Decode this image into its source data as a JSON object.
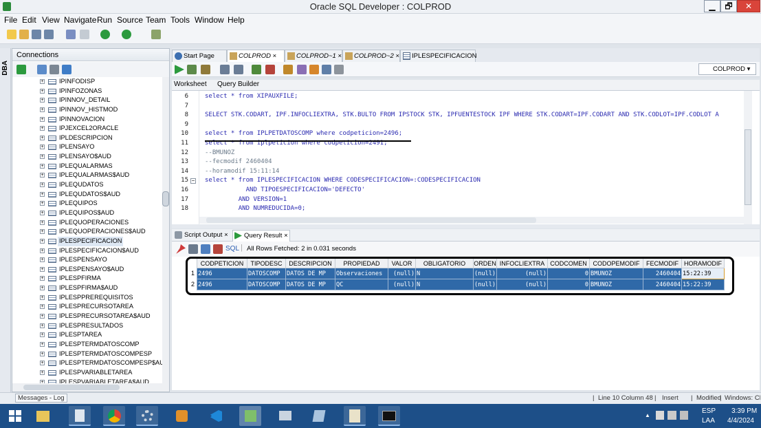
{
  "window": {
    "title": "Oracle SQL Developer : COLPROD",
    "minimize": "▁",
    "restore": "🗗",
    "close": "✕"
  },
  "menu": [
    "File",
    "Edit",
    "View",
    "Navigate",
    "Run",
    "Source",
    "Team",
    "Tools",
    "Window",
    "Help"
  ],
  "left_panel": {
    "side_tab": "DBA",
    "header": "Connections",
    "items": [
      "IPINFODISP",
      "IPINFOZONAS",
      "IPINNOV_DETAIL",
      "IPINNOV_HISTMOD",
      "IPINNOVACION",
      "IPJEXCEL2ORACLE",
      "IPLDESCRIPCION",
      "IPLENSAYO",
      "IPLENSAYO$AUD",
      "IPLEQUALARMAS",
      "IPLEQUALARMAS$AUD",
      "IPLEQUDATOS",
      "IPLEQUDATOS$AUD",
      "IPLEQUIPOS",
      "IPLEQUIPOS$AUD",
      "IPLEQUOPERACIONES",
      "IPLEQUOPERACIONES$AUD",
      "IPLESPECIFICACION",
      "IPLESPECIFICACION$AUD",
      "IPLESPENSAYO",
      "IPLESPENSAYO$AUD",
      "IPLESPFIRMA",
      "IPLESPFIRMA$AUD",
      "IPLESPPREREQUISITOS",
      "IPLESPRECURSOTAREA",
      "IPLESPRECURSOTAREA$AUD",
      "IPLESPRESULTADOS",
      "IPLESPTAREA",
      "IPLESPTERMDATOSCOMP",
      "IPLESPTERMDATOSCOMPESP",
      "IPLESPTERMDATOSCOMPESP$AUD",
      "IPLESPVARIABLETAREA",
      "IPLESPVARIABLETAREA$AUD"
    ],
    "selected_index": 17
  },
  "tabs": [
    {
      "label": "Start Page"
    },
    {
      "label": "COLPROD"
    },
    {
      "label": "COLPROD~1"
    },
    {
      "label": "COLPROD~2"
    },
    {
      "label": "IPLESPECIFICACION"
    }
  ],
  "connection_selector": "COLPROD",
  "subtabs": {
    "worksheet": "Worksheet",
    "query_builder": "Query Builder"
  },
  "editor": {
    "line_numbers": [
      "6",
      "7",
      "8",
      "9",
      "10",
      "11",
      "12",
      "13",
      "14",
      "15",
      "16",
      "17",
      "18"
    ],
    "lines": [
      "select * from XIPAUXFILE;",
      "",
      "SELECT STK.CODART, IPF.INFOCLIEXTRA, STK.BULTO FROM IPSTOCK STK, IPFUENTESTOCK IPF WHERE STK.CODART=IPF.CODART AND STK.CODLOT=IPF.CODLOT A",
      "",
      "select * from IPLPETDATOSCOMP where codpeticion=2496;",
      "select * from iplpeticion where codpeticion=2491;",
      "--BMUNOZ",
      "--fecmodif 2460404",
      "--horamodif 15:11:14",
      "select * from IPLESPECIFICACION WHERE CODESPECIFICACION=:CODESPECIFICACION",
      "           AND TIPOESPECIFICACION='DEFECTO'",
      "         AND VERSION=1",
      "         AND NUMREDUCIDA=0;"
    ]
  },
  "output_tabs": {
    "script_output": "Script Output",
    "query_result": "Query Result",
    "close": "×"
  },
  "result_toolbar": {
    "sql": "SQL",
    "fetch_status": "All Rows Fetched: 2 in 0.031 seconds"
  },
  "grid": {
    "columns": [
      "CODPETICION",
      "TIPODESC",
      "DESCRIPCION",
      "PROPIEDAD",
      "VALOR",
      "OBLIGATORIO",
      "ORDEN",
      "INFOCLIEXTRA",
      "CODCOMEN",
      "CODOPEMODIF",
      "FECMODIF",
      "HORAMODIF"
    ],
    "rows": [
      {
        "n": "1",
        "cells": [
          "2496",
          "DATOSCOMP",
          "DATOS DE MP",
          "Observaciones",
          "(null)",
          "N",
          "(null)",
          "(null)",
          "0",
          "BMUNOZ",
          "2460404",
          "15:22:39"
        ]
      },
      {
        "n": "2",
        "cells": [
          "2496",
          "DATOSCOMP",
          "DATOS DE MP",
          "QC",
          "(null)",
          "N",
          "(null)",
          "(null)",
          "0",
          "BMUNOZ",
          "2460404",
          "15:22:39"
        ]
      }
    ]
  },
  "status": {
    "messages_tab": "Messages - Log",
    "position": "Line 10 Column 48",
    "mode": "Insert",
    "modified": "Modified",
    "eol": "Windows: CR"
  },
  "taskbar": {
    "lang": "ESP",
    "lang2": "LAA",
    "time": "3:39 PM",
    "date": "4/4/2024"
  }
}
